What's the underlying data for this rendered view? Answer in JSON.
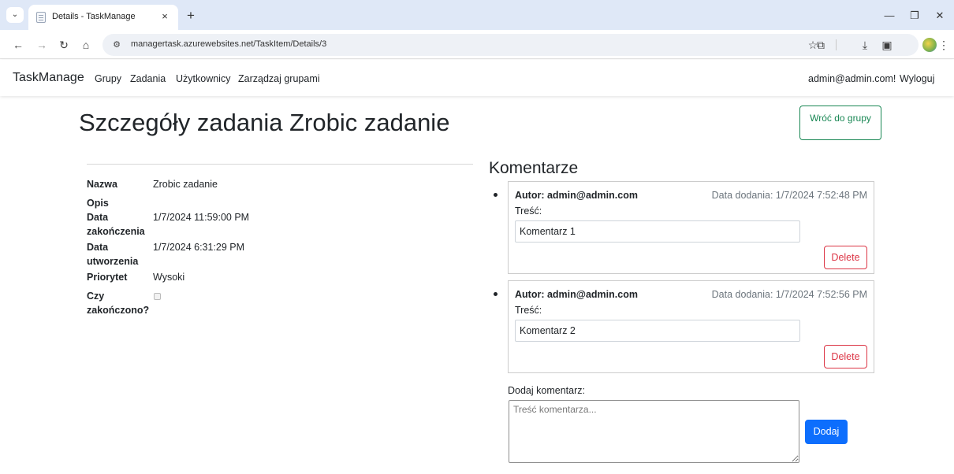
{
  "browser": {
    "tab_title": "Details - TaskManage",
    "tab_close": "×",
    "new_tab": "+",
    "url": "managertask.azurewebsites.net/TaskItem/Details/3",
    "icons": [
      "tab-search-icon",
      "page-favicon-icon",
      "back-arrow-icon",
      "forward-arrow-icon",
      "reload-icon",
      "home-icon",
      "site-info-icon",
      "bookmark-star-icon",
      "extensions-icon",
      "download-icon",
      "side-panel-icon",
      "profile-avatar-icon",
      "menu-dots-icon",
      "minimize-icon",
      "restore-icon",
      "close-window-icon"
    ]
  },
  "nav": {
    "brand": "TaskManage",
    "links": [
      "Grupy",
      "Zadania",
      "Użytkownicy",
      "Zarządzaj grupami"
    ],
    "user_greeting": "admin@admin.com!",
    "logout": "Wyloguj"
  },
  "page": {
    "title": "Szczegóły zadania Zrobic zadanie",
    "back_button": "Wróć do grupy"
  },
  "details": [
    {
      "label": "Nazwa",
      "value": "Zrobic zadanie"
    },
    {
      "label": "Opis",
      "value": ""
    },
    {
      "label": "Data zakończenia",
      "value": "1/7/2024 11:59:00 PM"
    },
    {
      "label": "Data utworzenia",
      "value": "1/7/2024 6:31:29 PM"
    },
    {
      "label": "Priorytet",
      "value": "Wysoki"
    },
    {
      "label": "Czy zakończono?",
      "value": "",
      "checked": false
    }
  ],
  "comments": {
    "title": "Komentarze",
    "items": [
      {
        "author": "Autor: admin@admin.com",
        "date": "Data dodania: 1/7/2024 7:52:48 PM",
        "content_label": "Treść:",
        "content": "Komentarz 1",
        "delete_label": "Delete"
      },
      {
        "author": "Autor: admin@admin.com",
        "date": "Data dodania: 1/7/2024 7:52:56 PM",
        "content_label": "Treść:",
        "content": "Komentarz 2",
        "delete_label": "Delete"
      }
    ],
    "add_label": "Dodaj komentarz:",
    "add_placeholder": "Treść komentarza...",
    "add_button": "Dodaj"
  },
  "colors": {
    "primary": "#0d6efd",
    "success": "#198754",
    "danger": "#dc3545",
    "tabstrip": "#dfe8f7"
  }
}
